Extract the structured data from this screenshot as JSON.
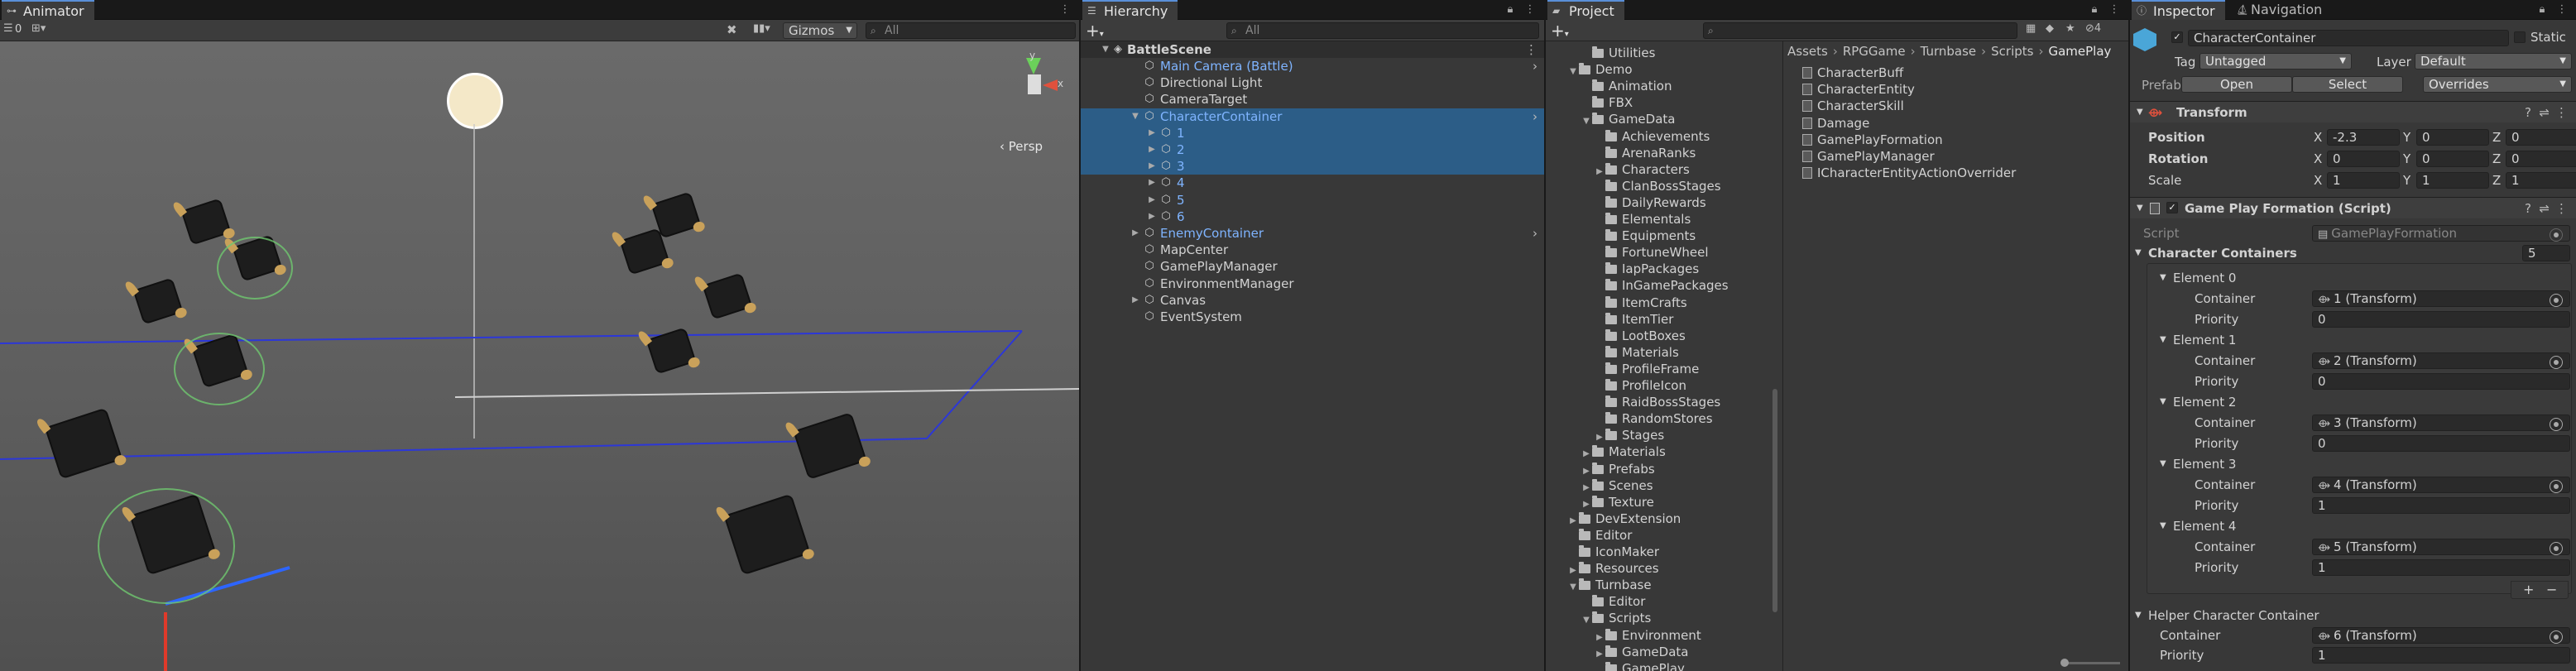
{
  "animator": {
    "tab": "Animator",
    "counter": "0",
    "gizmos": "Gizmos",
    "search_placeholder": "All",
    "persp": "Persp",
    "axis_y": "y",
    "axis_x": "x"
  },
  "hierarchy": {
    "tab": "Hierarchy",
    "search_placeholder": "All",
    "scene": "BattleScene",
    "items": [
      {
        "label": "Main Camera (Battle)",
        "blue": true
      },
      {
        "label": "Directional Light"
      },
      {
        "label": "CameraTarget"
      },
      {
        "label": "CharacterContainer",
        "blue": true
      },
      {
        "label": "1",
        "blue": true
      },
      {
        "label": "2",
        "blue": true
      },
      {
        "label": "3",
        "blue": true
      },
      {
        "label": "4",
        "blue": true
      },
      {
        "label": "5",
        "blue": true
      },
      {
        "label": "6",
        "blue": true
      },
      {
        "label": "EnemyContainer",
        "blue": true
      },
      {
        "label": "MapCenter"
      },
      {
        "label": "GamePlayManager"
      },
      {
        "label": "EnvironmentManager"
      },
      {
        "label": "Canvas"
      },
      {
        "label": "EventSystem"
      }
    ]
  },
  "project": {
    "tab": "Project",
    "hidden_count": "4",
    "breadcrumb": [
      "Assets",
      "RPGGame",
      "Turnbase",
      "Scripts",
      "GamePlay"
    ],
    "tree": [
      "Utilities",
      "Demo",
      "Animation",
      "FBX",
      "GameData",
      "Achievements",
      "ArenaRanks",
      "Characters",
      "ClanBossStages",
      "DailyRewards",
      "Elementals",
      "Equipments",
      "FortuneWheel",
      "IapPackages",
      "InGamePackages",
      "ItemCrafts",
      "ItemTier",
      "LootBoxes",
      "Materials",
      "ProfileFrame",
      "ProfileIcon",
      "RaidBossStages",
      "RandomStores",
      "Stages",
      "Materials",
      "Prefabs",
      "Scenes",
      "Texture",
      "DevExtension",
      "Editor",
      "IconMaker",
      "Resources",
      "Turnbase",
      "Editor",
      "Scripts",
      "Environment",
      "GameData",
      "GamePlay"
    ],
    "files": [
      "CharacterBuff",
      "CharacterEntity",
      "CharacterSkill",
      "Damage",
      "GamePlayFormation",
      "GamePlayManager",
      "ICharacterEntityActionOverrider"
    ]
  },
  "inspector": {
    "tab": "Inspector",
    "tab2": "Navigation",
    "object_name": "CharacterContainer",
    "static_label": "Static",
    "tag_label": "Tag",
    "tag_value": "Untagged",
    "layer_label": "Layer",
    "layer_value": "Default",
    "prefab_label": "Prefab",
    "open_btn": "Open",
    "select_btn": "Select",
    "overrides_btn": "Overrides",
    "transform_title": "Transform",
    "position_label": "Position",
    "rotation_label": "Rotation",
    "scale_label": "Scale",
    "position": {
      "x": "-2.3",
      "y": "0",
      "z": "0"
    },
    "rotation": {
      "x": "0",
      "y": "0",
      "z": "0"
    },
    "scale": {
      "x": "1",
      "y": "1",
      "z": "1"
    },
    "script_title": "Game Play Formation (Script)",
    "script_label": "Script",
    "script_value": "GamePlayFormation",
    "containers_label": "Character Containers",
    "containers_count": "5",
    "container_label": "Container",
    "priority_label": "Priority",
    "elements": [
      {
        "name": "Element 0",
        "container": "1 (Transform)",
        "priority": "0"
      },
      {
        "name": "Element 1",
        "container": "2 (Transform)",
        "priority": "0"
      },
      {
        "name": "Element 2",
        "container": "3 (Transform)",
        "priority": "0"
      },
      {
        "name": "Element 3",
        "container": "4 (Transform)",
        "priority": "1"
      },
      {
        "name": "Element 4",
        "container": "5 (Transform)",
        "priority": "1"
      }
    ],
    "helper_label": "Helper Character Container",
    "helper_container": "6 (Transform)",
    "helper_priority": "1"
  }
}
